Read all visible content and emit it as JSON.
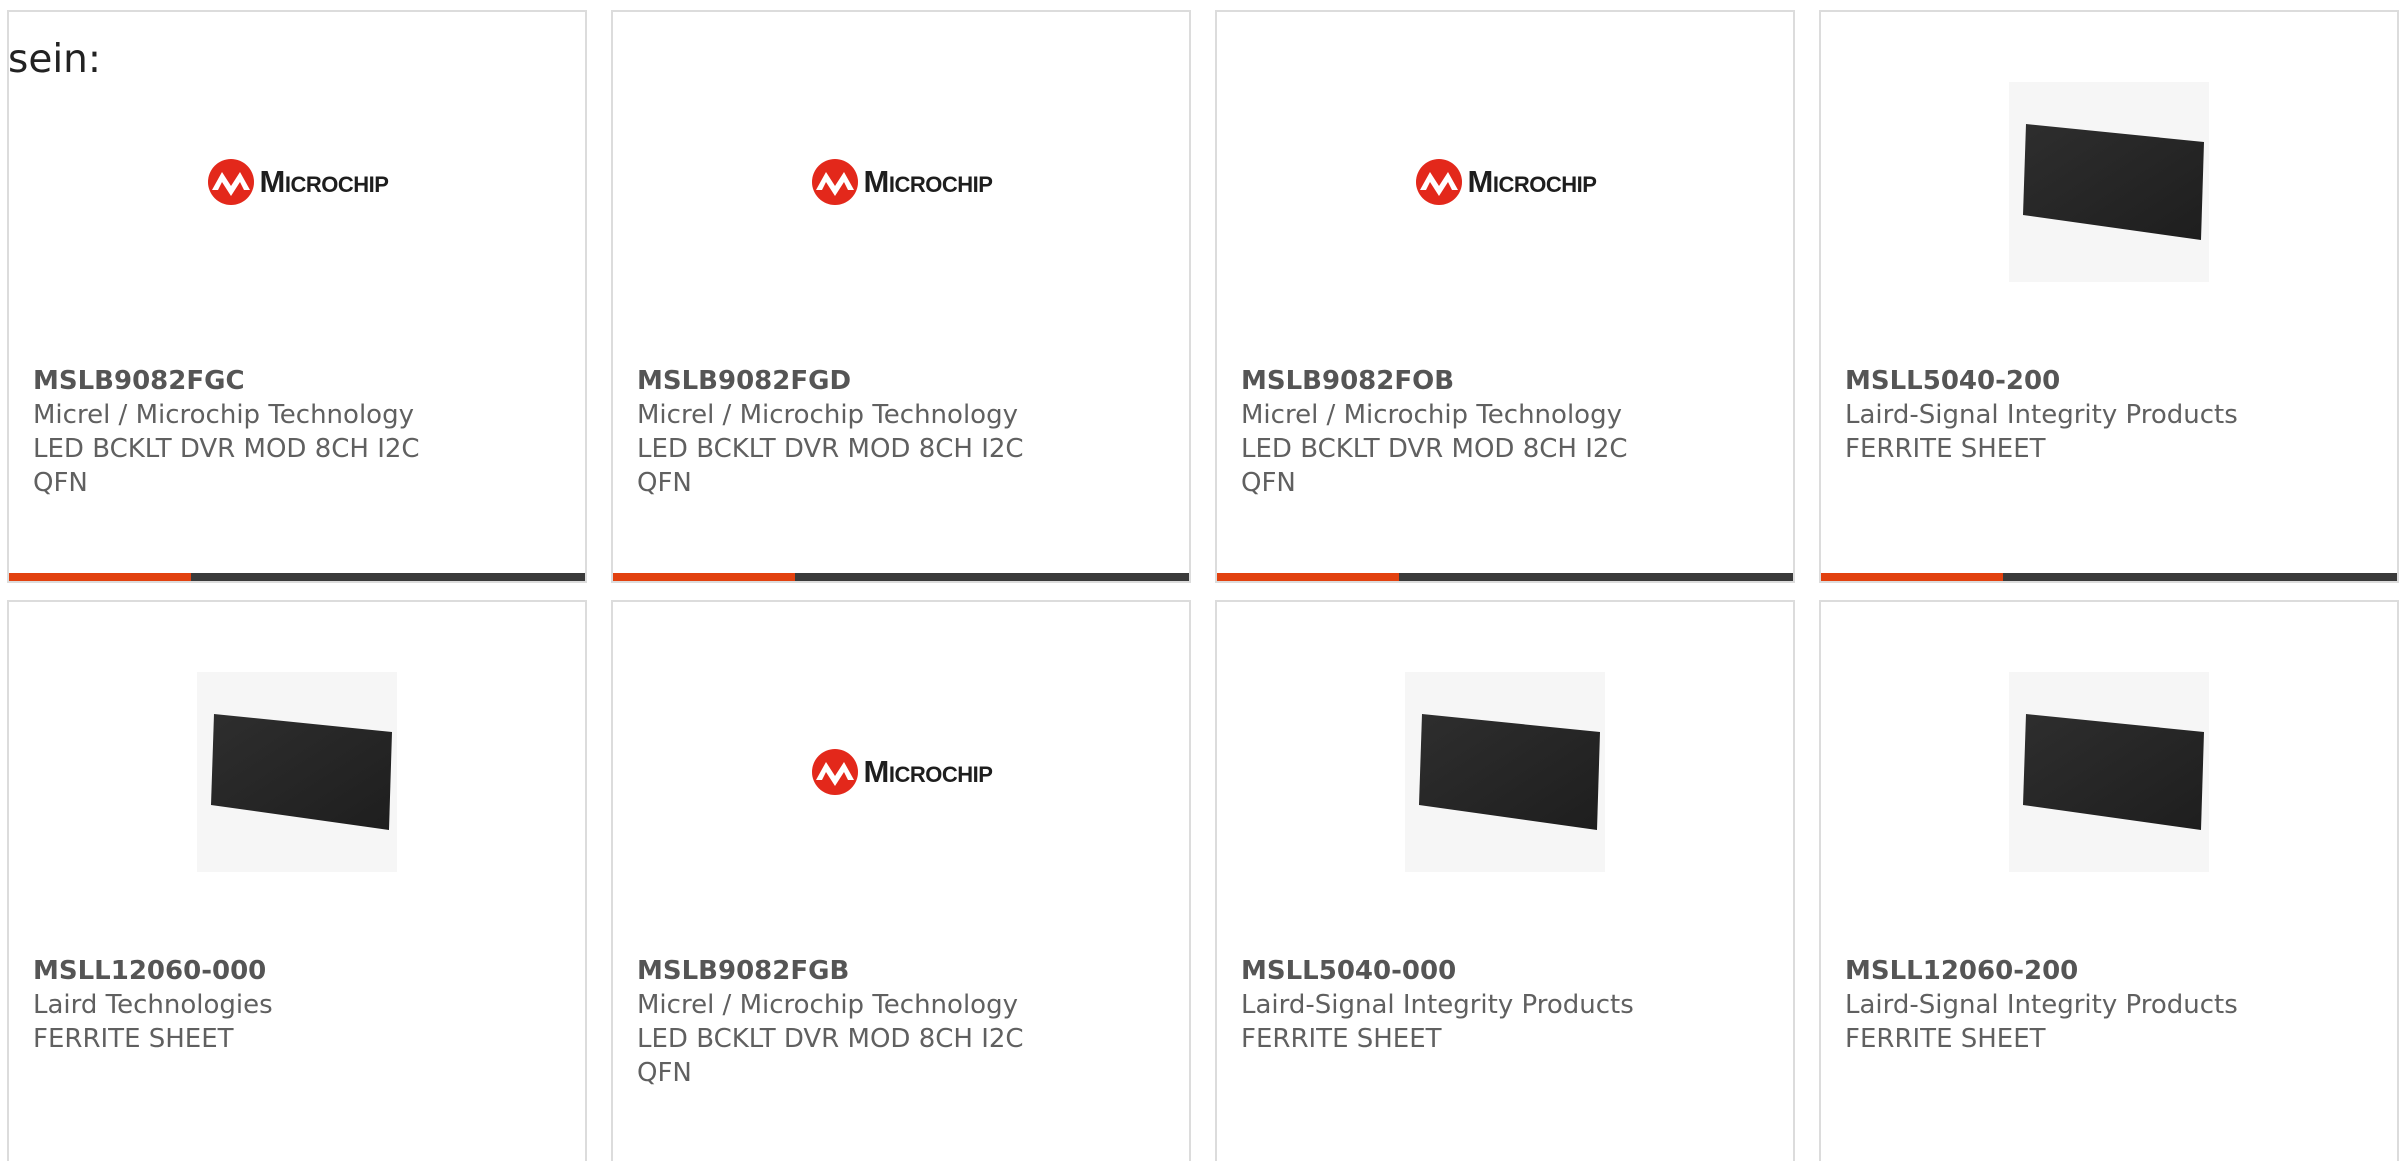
{
  "intro_text": "sein:",
  "brand_colors": {
    "accent": "#e2410f",
    "bar_dark": "#3a3a3a",
    "microchip_red": "#e3281b"
  },
  "products": [
    {
      "part_number": "MSLB9082FGC",
      "manufacturer": "Micrel / Microchip Technology",
      "desc1": "LED BCKLT DVR MOD 8CH I2C",
      "desc2": "QFN",
      "image": "microchip-logo",
      "logo_text": "Microchip"
    },
    {
      "part_number": "MSLB9082FGD",
      "manufacturer": "Micrel / Microchip Technology",
      "desc1": "LED BCKLT DVR MOD 8CH I2C",
      "desc2": "QFN",
      "image": "microchip-logo",
      "logo_text": "Microchip"
    },
    {
      "part_number": "MSLB9082FOB",
      "manufacturer": "Micrel / Microchip Technology",
      "desc1": "LED BCKLT DVR MOD 8CH I2C",
      "desc2": "QFN",
      "image": "microchip-logo",
      "logo_text": "Microchip"
    },
    {
      "part_number": "MSLL5040-200",
      "manufacturer": "Laird-Signal Integrity Products",
      "desc1": "FERRITE SHEET",
      "desc2": "",
      "image": "ferrite-sheet"
    },
    {
      "part_number": "MSLL12060-000",
      "manufacturer": "Laird Technologies",
      "desc1": "FERRITE SHEET",
      "desc2": "",
      "image": "ferrite-sheet"
    },
    {
      "part_number": "MSLB9082FGB",
      "manufacturer": "Micrel / Microchip Technology",
      "desc1": "LED BCKLT DVR MOD 8CH I2C",
      "desc2": "QFN",
      "image": "microchip-logo",
      "logo_text": "Microchip"
    },
    {
      "part_number": "MSLL5040-000",
      "manufacturer": "Laird-Signal Integrity Products",
      "desc1": "FERRITE SHEET",
      "desc2": "",
      "image": "ferrite-sheet"
    },
    {
      "part_number": "MSLL12060-200",
      "manufacturer": "Laird-Signal Integrity Products",
      "desc1": "FERRITE SHEET",
      "desc2": "",
      "image": "ferrite-sheet"
    }
  ]
}
